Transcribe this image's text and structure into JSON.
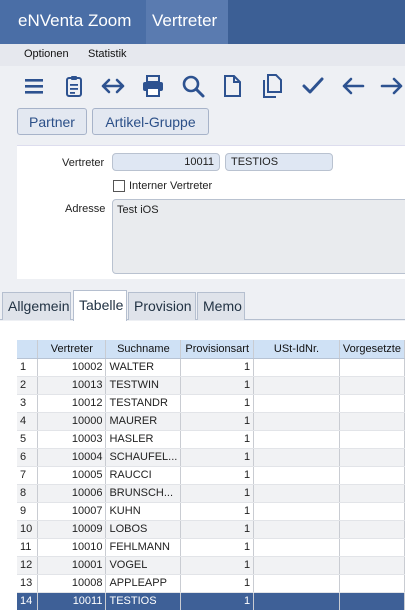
{
  "titlebar": {
    "app_tab": "eNVenta Zoom",
    "current_tab": "Vertreter"
  },
  "menu": {
    "items": [
      "Optionen",
      "Statistik"
    ]
  },
  "toolbar": {
    "icons": [
      "menu-icon",
      "clipboard-icon",
      "swap-horizontal-icon",
      "print-icon",
      "search-icon",
      "new-document-icon",
      "copy-document-icon",
      "checkmark-icon",
      "arrow-left-icon",
      "arrow-right-icon"
    ]
  },
  "links": {
    "partner": "Partner",
    "artikel_gruppe": "Artikel-Gruppe"
  },
  "form": {
    "vertreter_label": "Vertreter",
    "vertreter_number": "10011",
    "vertreter_name": "TESTIOS",
    "interner_label": "Interner Vertreter",
    "interner_checked": false,
    "adresse_label": "Adresse",
    "adresse_value": "Test iOS"
  },
  "tabs": [
    "Allgemein",
    "Tabelle",
    "Provision",
    "Memo"
  ],
  "active_tab": "Tabelle",
  "table": {
    "columns": [
      "",
      "Vertreter",
      "Suchname",
      "Provisionsart",
      "USt-IdNr.",
      "Vorgesetzte"
    ],
    "rows": [
      [
        "1",
        "10002",
        "WALTER",
        "1",
        "",
        ""
      ],
      [
        "2",
        "10013",
        "TESTWIN",
        "1",
        "",
        ""
      ],
      [
        "3",
        "10012",
        "TESTANDR",
        "1",
        "",
        ""
      ],
      [
        "4",
        "10000",
        "MAURER",
        "1",
        "",
        ""
      ],
      [
        "5",
        "10003",
        "HASLER",
        "1",
        "",
        ""
      ],
      [
        "6",
        "10004",
        "SCHAUFEL...",
        "1",
        "",
        ""
      ],
      [
        "7",
        "10005",
        "RAUCCI",
        "1",
        "",
        ""
      ],
      [
        "8",
        "10006",
        "BRUNSCH...",
        "1",
        "",
        ""
      ],
      [
        "9",
        "10007",
        "KUHN",
        "1",
        "",
        ""
      ],
      [
        "10",
        "10009",
        "LOBOS",
        "1",
        "",
        ""
      ],
      [
        "11",
        "10010",
        "FEHLMANN",
        "1",
        "",
        ""
      ],
      [
        "12",
        "10001",
        "VOGEL",
        "1",
        "",
        ""
      ],
      [
        "13",
        "10008",
        "APPLEAPP",
        "1",
        "",
        ""
      ],
      [
        "14",
        "10011",
        "TESTIOS",
        "1",
        "",
        ""
      ]
    ],
    "selected_row": 13
  },
  "colors": {
    "titlebar": "#3c5f95",
    "link": "#2b4f88",
    "header": "#cfe1f5",
    "selection": "#3e6097"
  }
}
